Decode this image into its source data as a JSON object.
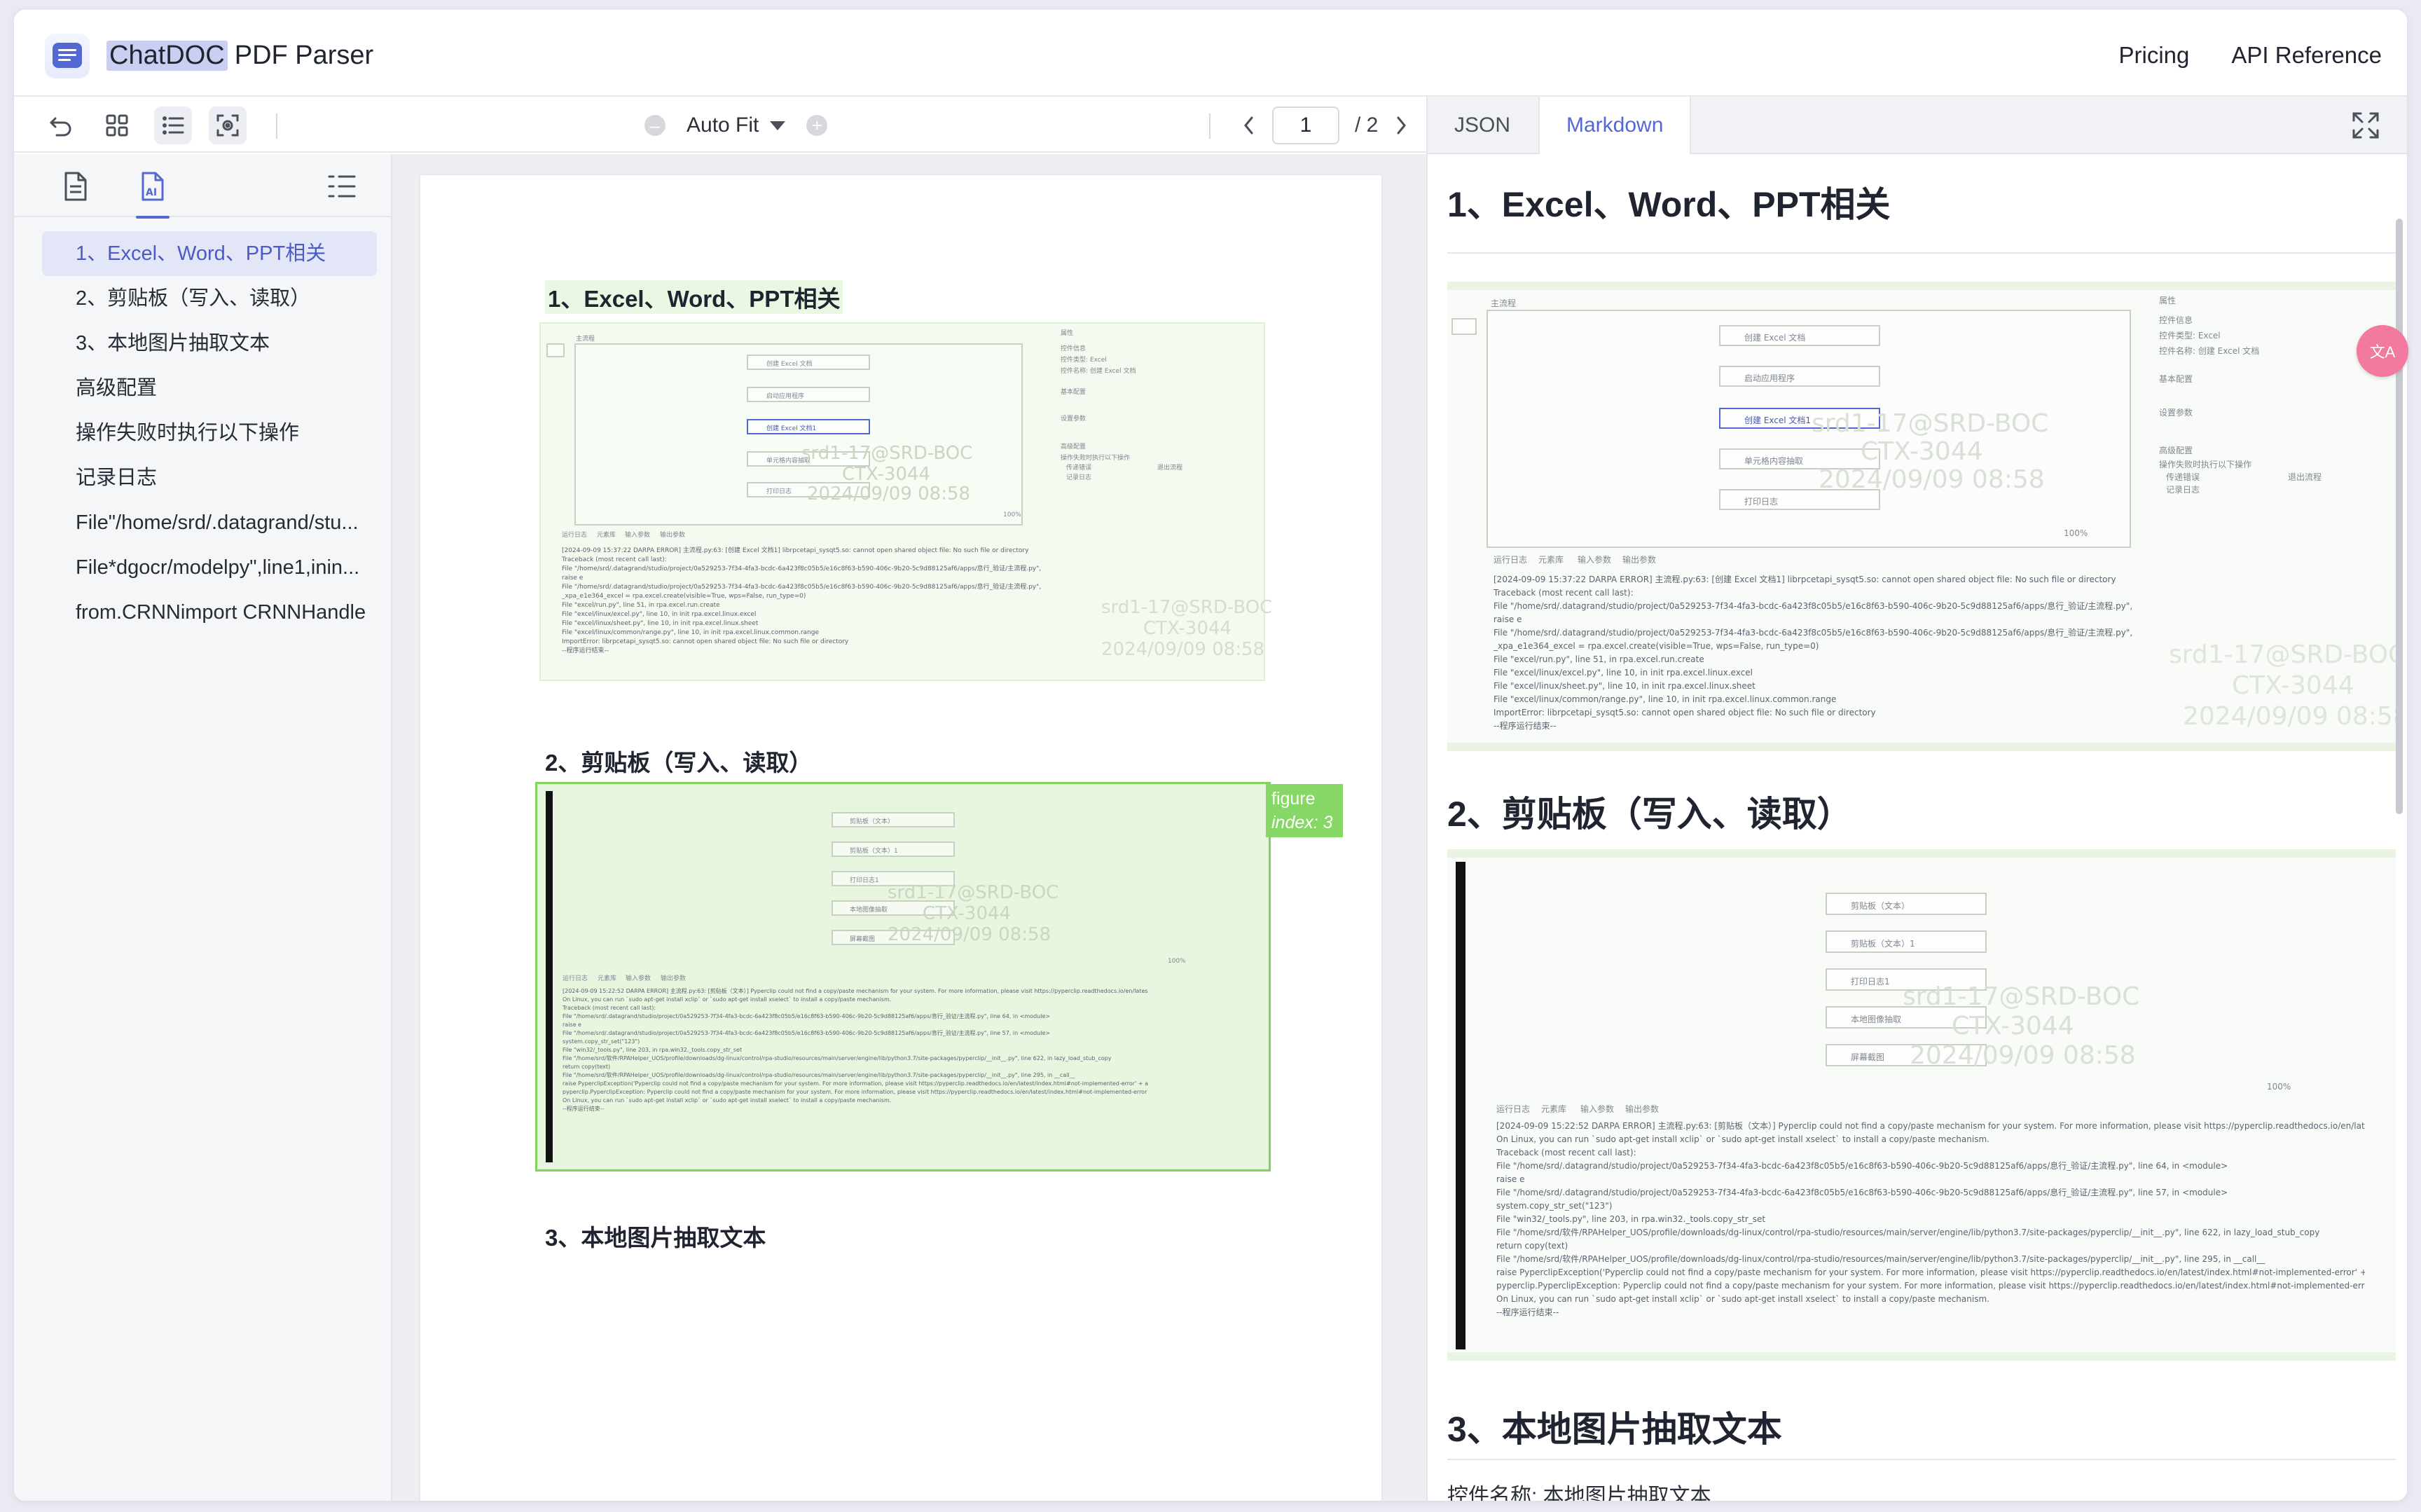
{
  "app": {
    "brand_highlight": "ChatDOC",
    "brand_rest": "PDF Parser",
    "nav": {
      "pricing": "Pricing",
      "api": "API Reference"
    }
  },
  "toolbar": {
    "zoom_label": "Auto Fit",
    "zoom_out": "–",
    "zoom_in": "+",
    "page_current": "1",
    "page_total": "/ 2"
  },
  "outline": [
    "1、Excel、Word、PPT相关",
    "2、剪贴板（写入、读取）",
    "3、本地图片抽取文本",
    "高级配置",
    "操作失败时执行以下操作",
    "记录日志",
    "File\"/home/srd/.datagrand/stu...",
    "File*dgocr/modelpy\",line1,inin...",
    "from.CRNNimport CRNNHandle"
  ],
  "page": {
    "h1": "1、Excel、Word、PPT相关",
    "h2": "2、剪贴板（写入、读取）",
    "h3": "3、本地图片抽取文本",
    "figure_tag_type": "figure",
    "figure_tag_index": "index: 3"
  },
  "right_panel": {
    "tabs": [
      "JSON",
      "Markdown"
    ],
    "h1": "1、Excel、Word、PPT相关",
    "h2": "2、剪贴板（写入、读取）",
    "h3": "3、本地图片抽取文本",
    "body_tail": "控件名称: 本地图片抽取文本",
    "float_label": "文A"
  },
  "screenshot_text": {
    "fig1_lines": [
      "[2024-09-09 15:37:22 DARPA ERROR] 主流程.py:63: [创建 Excel 文档1] librpcetapi_sysqt5.so: cannot open shared object file: No such file or directory",
      "Traceback (most recent call last):",
      "File \"/home/srd/.datagrand/studio/project/0a529253-7f34-4fa3-bcdc-6a423f8c05b5/e16c8f63-b590-406c-9b20-5c9d88125af6/apps/息行_验证/主流程.py\",",
      "raise e",
      "File \"/home/srd/.datagrand/studio/project/0a529253-7f34-4fa3-bcdc-6a423f8c05b5/e16c8f63-b590-406c-9b20-5c9d88125af6/apps/息行_验证/主流程.py\",",
      "_xpa_e1e364_excel = rpa.excel.create(visible=True, wps=False, run_type=0)",
      "File \"excel/run.py\", line 51, in rpa.excel.run.create",
      "File \"excel/linux/excel.py\", line 10, in init rpa.excel.linux.excel",
      "File \"excel/linux/sheet.py\", line 10, in init rpa.excel.linux.sheet",
      "File \"excel/linux/common/range.py\", line 10, in init rpa.excel.linux.common.range",
      "ImportError: librpcetapi_sysqt5.so: cannot open shared object file: No such file or directory",
      "--程序运行结束--"
    ],
    "fig2_lines": [
      "[2024-09-09 15:22:52 DARPA ERROR] 主流程.py:63: [剪贴板（文本）] Pyperclip could not find a copy/paste mechanism for your system. For more information, please visit https://pyperclip.readthedocs.io/en/lates",
      "On Linux, you can run `sudo apt-get install xclip` or `sudo apt-get install xselect` to install a copy/paste mechanism.",
      "Traceback (most recent call last):",
      "File \"/home/srd/.datagrand/studio/project/0a529253-7f34-4fa3-bcdc-6a423f8c05b5/e16c8f63-b590-406c-9b20-5c9d88125af6/apps/息行_验证/主流程.py\", line 64, in <module>",
      "raise e",
      "File \"/home/srd/.datagrand/studio/project/0a529253-7f34-4fa3-bcdc-6a423f8c05b5/e16c8f63-b590-406c-9b20-5c9d88125af6/apps/息行_验证/主流程.py\", line 57, in <module>",
      "system.copy_str_set(\"123\")",
      "File \"win32/_tools.py\", line 203, in rpa.win32._tools.copy_str_set",
      "File \"/home/srd/软件/RPAHelper_UOS/profile/downloads/dg-linux/control/rpa-studio/resources/main/server/engine/lib/python3.7/site-packages/pyperclip/__init__.py\", line 622, in lazy_load_stub_copy",
      "return copy(text)",
      "File \"/home/srd/软件/RPAHelper_UOS/profile/downloads/dg-linux/control/rpa-studio/resources/main/server/engine/lib/python3.7/site-packages/pyperclip/__init__.py\", line 295, in __call__",
      "raise PyperclipException('Pyperclip could not find a copy/paste mechanism for your system. For more information, please visit https://pyperclip.readthedocs.io/en/latest/index.html#not-implemented-error' + a",
      "pyperclip.PyperclipException: Pyperclip could not find a copy/paste mechanism for your system. For more information, please visit https://pyperclip.readthedocs.io/en/latest/index.html#not-implemented-error",
      "On Linux, you can run `sudo apt-get install xclip` or `sudo apt-get install xselect` to install a copy/paste mechanism.",
      "--程序运行结束--"
    ],
    "watermark_1": "srd1-17@SRD-BOC",
    "watermark_2": "CTX-3044",
    "watermark_3": "2024/09/09 08:58",
    "panel_tabs": [
      "运行日志",
      "元素库",
      "输入参数",
      "输出参数"
    ],
    "props_title": "属性",
    "props_items": [
      "控件信息",
      "控件类型: Excel",
      "控件名称: 创建 Excel 文档",
      "基本配置",
      "设置参数",
      "高级配置",
      "操作失败时执行以下操作",
      "传递错误",
      "退出流程",
      "记录日志"
    ],
    "flow_nodes_1": [
      "创建 Excel 文档",
      "启动应用程序",
      "创建 Excel 文档1",
      "单元格内容抽取",
      "打印日志"
    ],
    "flow_nodes_2": [
      "剪贴板（文本）",
      "剪贴板（文本）1",
      "打印日志1",
      "本地图像抽取",
      "屏幕截图"
    ],
    "main_flow": "主流程",
    "zoom": "100%"
  }
}
